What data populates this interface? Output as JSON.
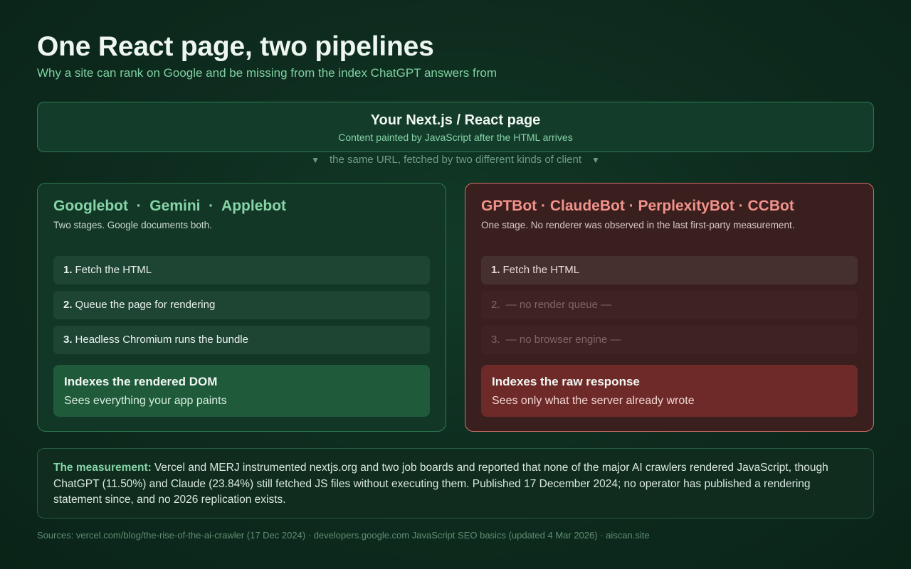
{
  "header": {
    "title": "One React page, two pipelines",
    "subtitle": "Why a site can rank on Google and be missing from the index ChatGPT answers from"
  },
  "page_box": {
    "title": "Your Next.js / React page",
    "subtitle": "Content painted by JavaScript after the HTML arrives"
  },
  "connector": {
    "arrow": "▼",
    "text": "the same URL, fetched by two different kinds of client"
  },
  "left_panel": {
    "heading": "Googlebot  ·  Gemini  ·  Applebot",
    "description": "Two stages. Google documents both.",
    "steps": [
      {
        "num": "1.",
        "text": "Fetch the HTML"
      },
      {
        "num": "2.",
        "text": "Queue the page for rendering"
      },
      {
        "num": "3.",
        "text": "Headless Chromium runs the bundle"
      }
    ],
    "result_title": "Indexes the rendered DOM",
    "result_sub": "Sees everything your app paints"
  },
  "right_panel": {
    "heading": "GPTBot · ClaudeBot · PerplexityBot · CCBot",
    "description": "One stage. No renderer was observed in the last first-party measurement.",
    "steps": [
      {
        "num": "1.",
        "text": "Fetch the HTML"
      },
      {
        "num": "2.",
        "text": "— no render queue —"
      },
      {
        "num": "3.",
        "text": "— no browser engine —"
      }
    ],
    "result_title": "Indexes the raw response",
    "result_sub": "Sees only what the server already wrote"
  },
  "measurement": {
    "label": "The measurement:",
    "text": "Vercel and MERJ instrumented nextjs.org and two job boards and reported that none of the major AI crawlers rendered JavaScript, though ChatGPT (11.50%) and Claude (23.84%) still fetched JS files without executing them. Published 17 December 2024; no operator has published a rendering statement since, and no 2026 replication exists."
  },
  "sources": "Sources: vercel.com/blog/the-rise-of-the-ai-crawler (17 Dec 2024) · developers.google.com JavaScript SEO basics (updated 4 Mar 2026) · aiscan.site",
  "colors": {
    "background": "#0d2b1e",
    "green_accent": "#86d4a7",
    "red_accent": "#f2928b",
    "green_result": "#1f5a3b",
    "red_result": "#6e2a28"
  }
}
